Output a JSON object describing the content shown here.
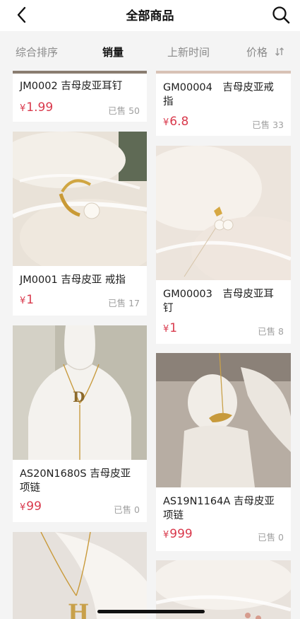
{
  "header": {
    "title": "全部商品",
    "back_icon": "chevron-left-icon",
    "search_icon": "search-icon"
  },
  "sort_tabs": [
    {
      "label": "综合排序",
      "active": false
    },
    {
      "label": "销量",
      "active": true
    },
    {
      "label": "上新时间",
      "active": false
    },
    {
      "label": "价格",
      "active": false,
      "icon": "sort-arrows-icon"
    }
  ],
  "colors": {
    "price": "#d9394c",
    "sold": "#a0a0a0",
    "background": "#f4f4f4"
  },
  "products": [
    {
      "name": "JM0002 吉母皮亚耳钉",
      "currency": "¥",
      "price": "1.99",
      "sold": "已售 50"
    },
    {
      "name": "GM00004　吉母皮亚戒指",
      "currency": "¥",
      "price": "6.8",
      "sold": "已售 33"
    },
    {
      "name": "JM0001 吉母皮亚  戒指",
      "currency": "¥",
      "price": "1",
      "sold": "已售 17"
    },
    {
      "name": "GM00003　吉母皮亚耳钉",
      "currency": "¥",
      "price": "1",
      "sold": "已售 8"
    },
    {
      "name": "AS20N1680S 吉母皮亚项链",
      "currency": "¥",
      "price": "99",
      "sold": "已售 0"
    },
    {
      "name": "AS19N1164A 吉母皮亚项链",
      "currency": "¥",
      "price": "999",
      "sold": "已售 0"
    }
  ]
}
